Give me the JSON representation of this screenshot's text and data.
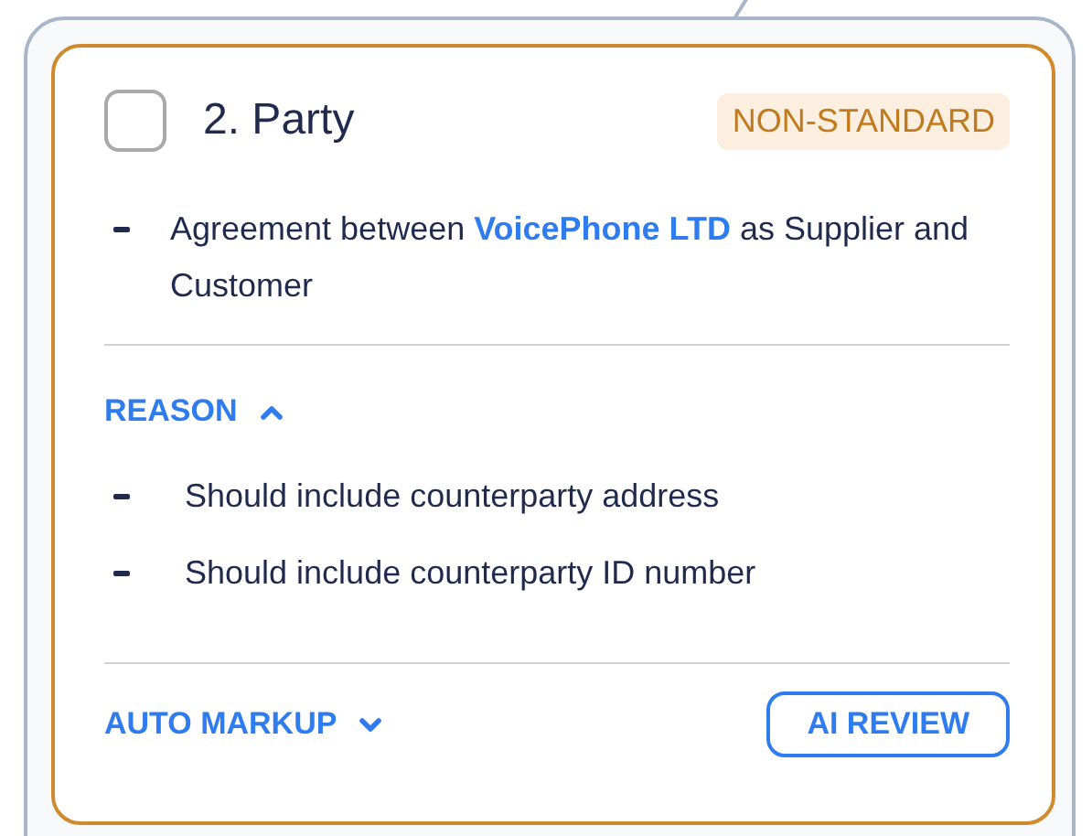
{
  "clause": {
    "checked": false,
    "title": "2. Party",
    "badge": "NON-STANDARD",
    "summary": [
      {
        "kind": "text",
        "text": "Agreement between "
      },
      {
        "kind": "link",
        "text": "VoicePhone LTD"
      },
      {
        "kind": "text",
        "text": " as Supplier and Customer"
      }
    ],
    "reason": {
      "label": "REASON",
      "expanded": true,
      "items": [
        "Should include counterparty address",
        "Should include counterparty ID number"
      ]
    },
    "auto_markup": {
      "label": "AUTO MARKUP",
      "expanded": false
    },
    "review_button": "AI REVIEW"
  }
}
